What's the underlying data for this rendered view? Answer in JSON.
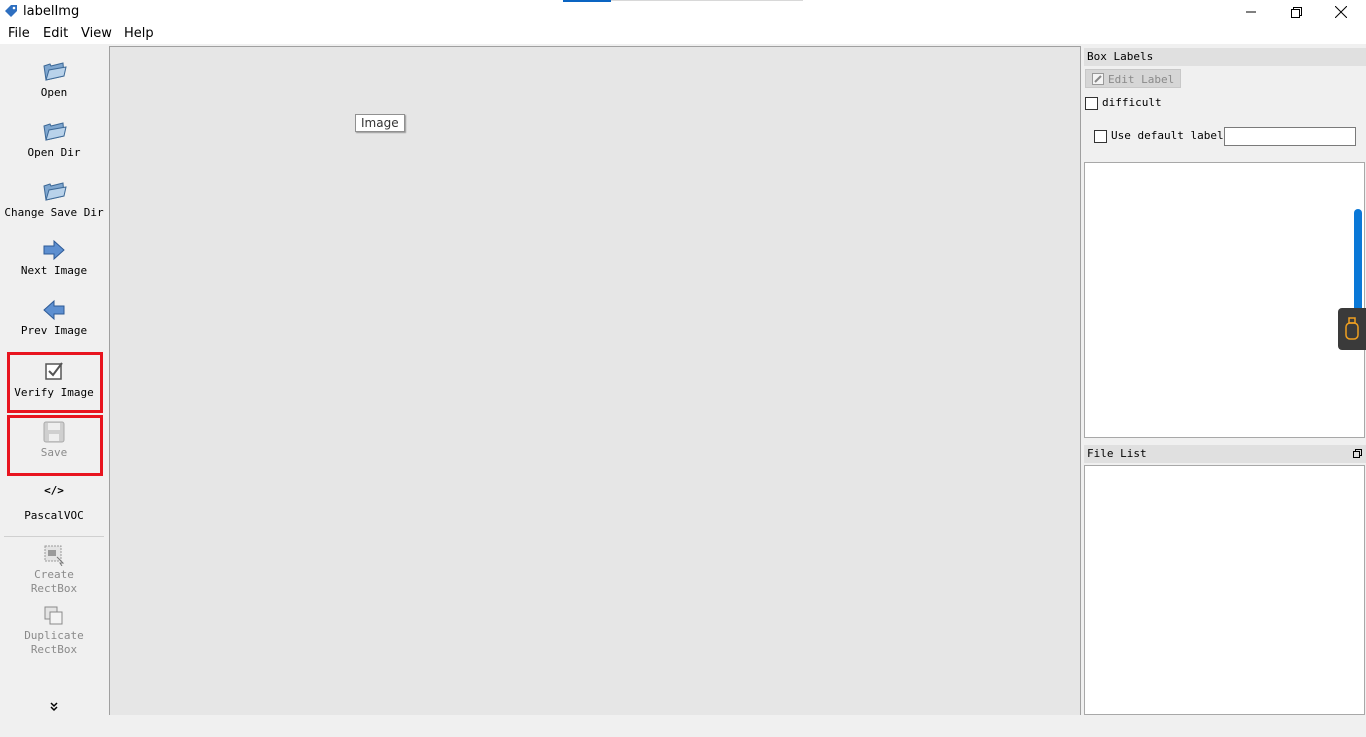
{
  "window": {
    "title": "labelImg"
  },
  "menu": [
    "File",
    "Edit",
    "View",
    "Help"
  ],
  "toolbar": {
    "items": [
      {
        "label": "Open",
        "icon": "folder-open-icon",
        "enabled": true
      },
      {
        "label": "Open Dir",
        "icon": "folder-open-icon",
        "enabled": true
      },
      {
        "label": "Change Save Dir",
        "icon": "folder-open-icon",
        "enabled": true
      },
      {
        "label": "Next Image",
        "icon": "arrow-right-icon",
        "enabled": true
      },
      {
        "label": "Prev Image",
        "icon": "arrow-left-icon",
        "enabled": true
      },
      {
        "label": "Verify Image",
        "icon": "checkbox-icon",
        "enabled": true,
        "highlighted": true
      },
      {
        "label": "Save",
        "icon": "floppy-disk-icon",
        "enabled": false,
        "highlighted": true
      },
      {
        "label": "PascalVOC",
        "icon": "code-icon",
        "enabled": true
      },
      {
        "label_lines": [
          "Create",
          "RectBox"
        ],
        "icon": "create-rectbox-icon",
        "enabled": false
      },
      {
        "label_lines": [
          "Duplicate",
          "RectBox"
        ],
        "icon": "duplicate-rectbox-icon",
        "enabled": false
      }
    ],
    "more_icon": "chevron-double-down-icon"
  },
  "canvas": {
    "image_tag": "Image"
  },
  "box_labels": {
    "title": "Box Labels",
    "edit_label_button": "Edit Label",
    "difficult_label": "difficult",
    "use_default_label": "Use default label",
    "default_label_value": ""
  },
  "file_list": {
    "title": "File List"
  },
  "colors": {
    "highlight": "#e8141f",
    "accent": "#0a78d7",
    "canvas": "#e6e6e6"
  }
}
